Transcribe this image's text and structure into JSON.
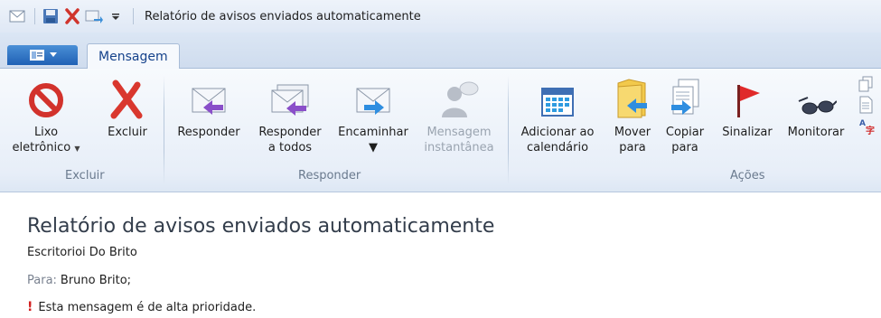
{
  "window": {
    "title": "Relatório de avisos enviados automaticamente"
  },
  "tabs": {
    "file_menu_icon": "file-menu-icon",
    "active": "Mensagem"
  },
  "ribbon": {
    "groups": {
      "excluir": "Excluir",
      "responder": "Responder",
      "acoes": "Ações"
    },
    "buttons": {
      "junk": [
        "Lixo",
        "eletrônico"
      ],
      "delete": "Excluir",
      "reply": "Responder",
      "reply_all": [
        "Responder",
        "a todos"
      ],
      "forward": "Encaminhar",
      "im": [
        "Mensagem",
        "instantânea"
      ],
      "add_calendar": [
        "Adicionar ao",
        "calendário"
      ],
      "move": [
        "Mover",
        "para"
      ],
      "copy": [
        "Copiar",
        "para"
      ],
      "flag": "Sinalizar",
      "watch": "Monitorar"
    }
  },
  "message": {
    "subject": "Relatório de avisos enviados automaticamente",
    "sender": "Escritorioi Do Brito",
    "to_label": "Para:",
    "to_value": "Bruno Brito;",
    "priority_mark": "!",
    "priority_text": "Esta mensagem é de alta prioridade."
  },
  "colors": {
    "accent": "#15428b",
    "priority": "#d21f1f",
    "disabled": "#9aa4b0"
  }
}
